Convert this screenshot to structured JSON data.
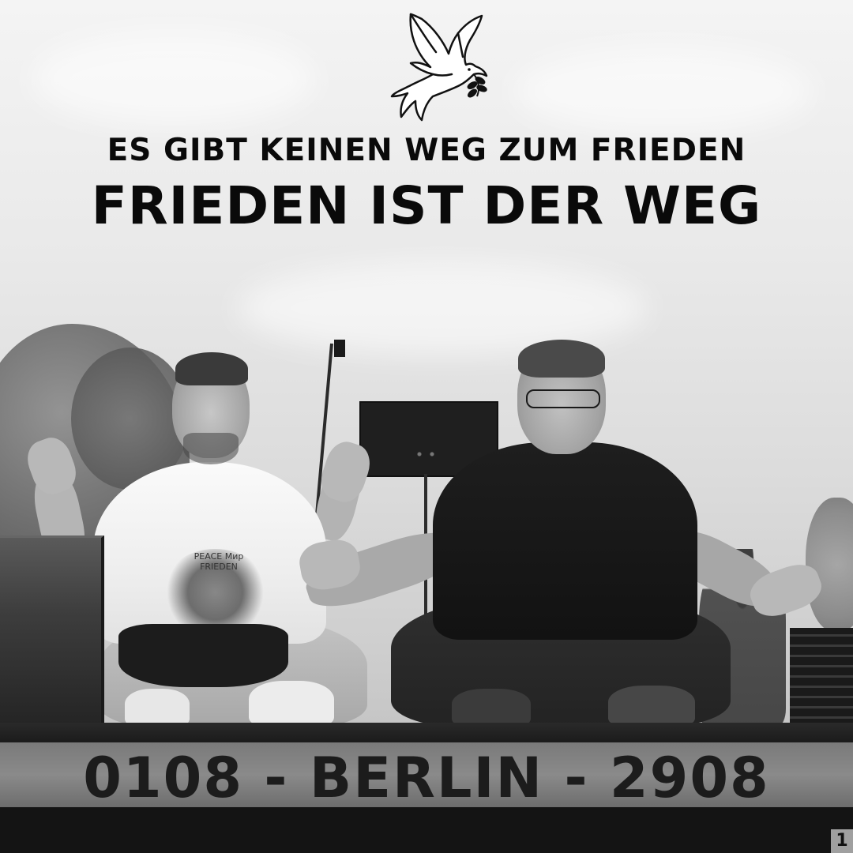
{
  "poster": {
    "headline_line1": "ES GIBT KEINEN WEG ZUM FRIEDEN",
    "headline_line2": "FRIEDEN IST DER WEG",
    "stage_banner": "0108 - BERLIN - 2908",
    "shirt_print": "PEACE Мир FRIEDEN",
    "stage_tag": "1"
  },
  "icons": {
    "dove": "dove-with-olive-branch-icon"
  },
  "colors": {
    "text": "#0a0a0a",
    "stage": "#1b1b1b"
  }
}
